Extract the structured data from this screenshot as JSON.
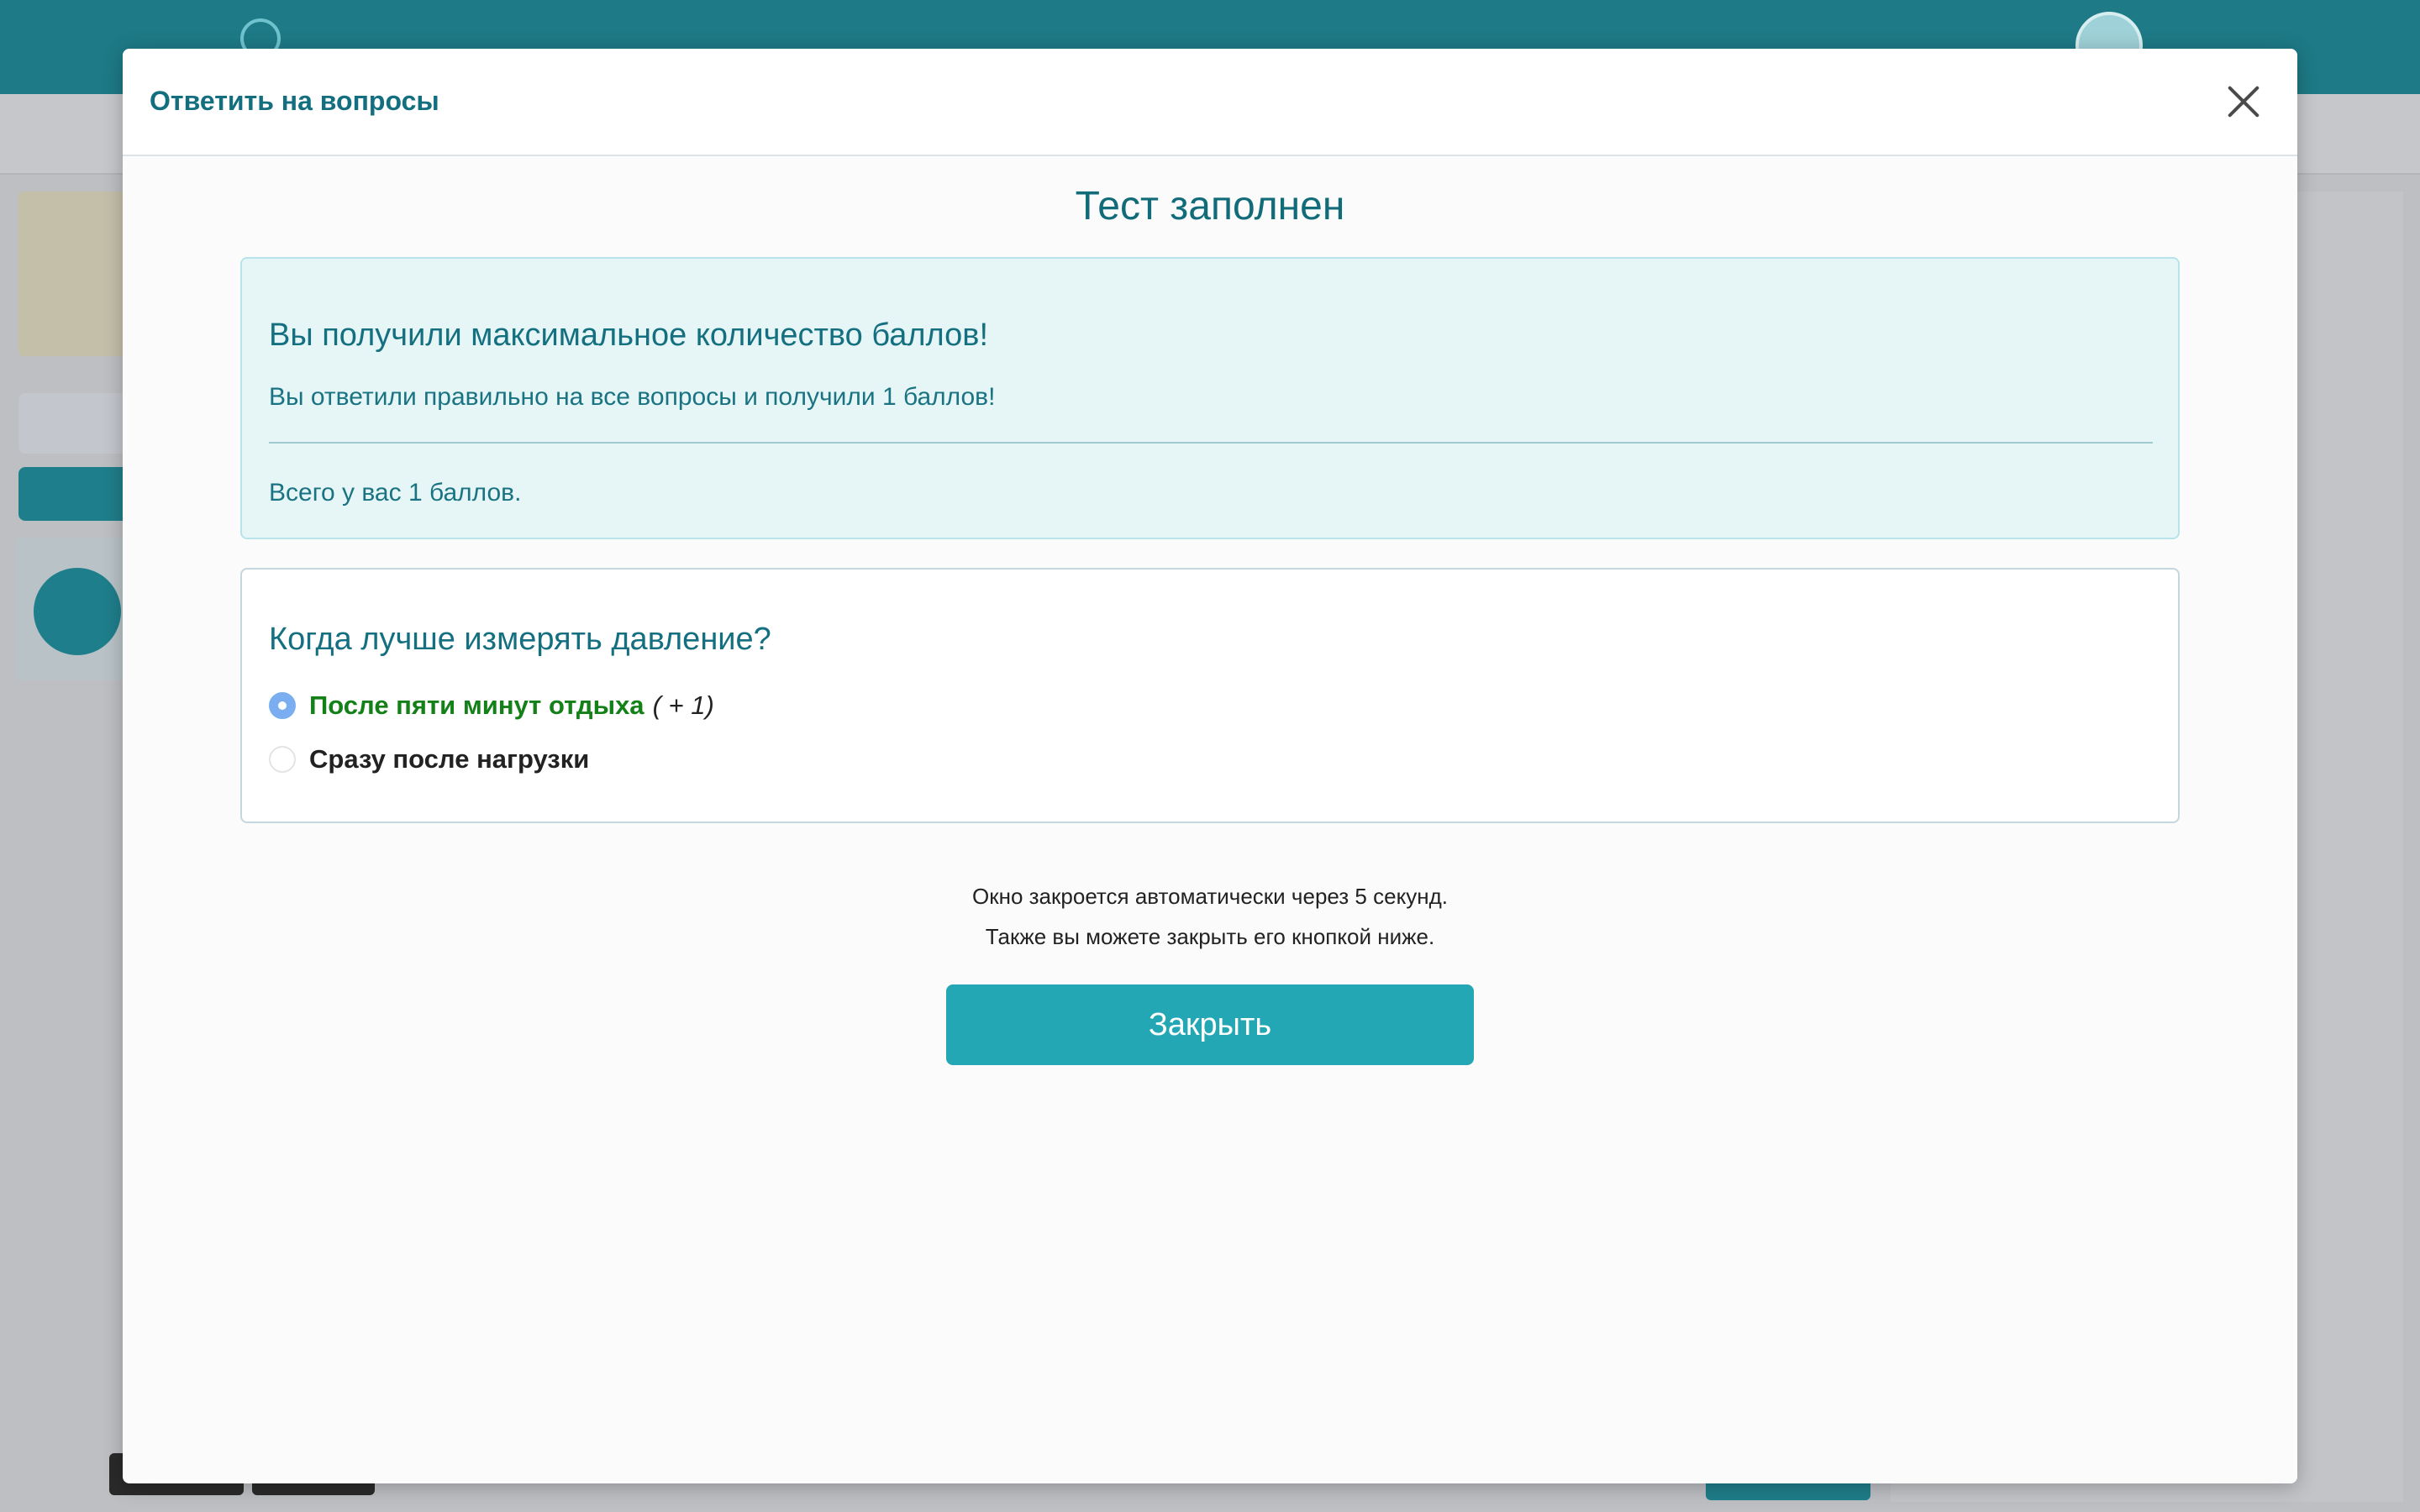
{
  "modal": {
    "title": "Ответить на вопросы"
  },
  "result": {
    "title": "Тест заполнен",
    "heading": "Вы получили максимальное количество баллов!",
    "text": "Вы ответили правильно на все вопросы и получили 1 баллов!",
    "total": "Всего у вас 1 баллов."
  },
  "question": {
    "text": "Когда лучше измерять давление?",
    "options": [
      {
        "label": "После пяти минут отдыха",
        "points": "( + 1)",
        "selected": true,
        "correct": true
      },
      {
        "label": "Сразу после нагрузки",
        "points": "",
        "selected": false,
        "correct": false
      }
    ]
  },
  "auto_close": {
    "line1": "Окно закроется автоматически через 5 секунд.",
    "line2": "Также вы можете закрыть его кнопкой ниже."
  },
  "buttons": {
    "close_label": "Закрыть"
  },
  "colors": {
    "accent": "#24a7b5",
    "title_teal": "#136f80",
    "correct_green": "#138018",
    "radio_selected": "#7aaef0"
  },
  "icons": {
    "close": "close-icon"
  }
}
